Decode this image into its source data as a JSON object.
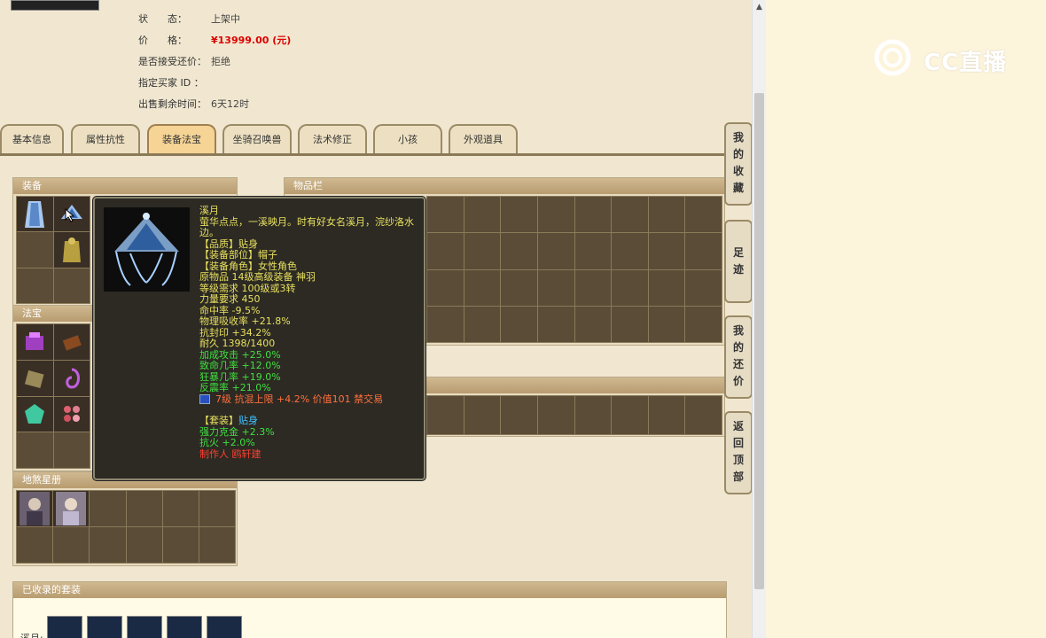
{
  "info": {
    "status_label": "状　　态：",
    "status_value": "上架中",
    "price_label": "价　　格：",
    "price_value": "¥13999.00 (元)",
    "bargain_label": "是否接受还价：",
    "bargain_value": "拒绝",
    "buyer_label": "指定买家 ID ：",
    "buyer_value": "",
    "remaining_label": "出售剩余时间：",
    "remaining_value": "6天12时"
  },
  "tabs": [
    {
      "label": "基本信息"
    },
    {
      "label": "属性抗性"
    },
    {
      "label": "装备法宝",
      "active": true
    },
    {
      "label": "坐骑召唤兽"
    },
    {
      "label": "法术修正"
    },
    {
      "label": "小孩"
    },
    {
      "label": "外观道具"
    }
  ],
  "panels": {
    "equipment": "装备",
    "treasure": "法宝",
    "tablet": "地煞星册",
    "inventory": "物品栏",
    "collected_sets": "已收录的套装"
  },
  "tooltip": {
    "name": "溪月",
    "desc1": "萤华点点，一溪映月。时有好女名溪月，浣纱洛水",
    "desc2": "边。",
    "quality": "【品质】贴身",
    "slot": "【装备部位】帽子",
    "role": "【装备角色】女性角色",
    "origin": "原物品 14级高级装备 神羽",
    "level_req": "等级需求 100级或3转",
    "str_req": "力量要求 450",
    "hit": "命中率 -9.5%",
    "phys_absorb": "物理吸收率 +21.8%",
    "seal_res": "抗封印 +34.2%",
    "durability": "耐久 1398/1400",
    "atk_bonus": "加成攻击 +25.0%",
    "crit_rate": "致命几率 +12.0%",
    "frenzy_rate": "狂暴几率 +19.0%",
    "counter_rate": "反震率 +21.0%",
    "gem_text": "7级 抗混上限 +4.2% 价值101 禁交易",
    "set_prefix": "【套装】",
    "set_name": "贴身",
    "set_bonus1": "强力克金 +2.3%",
    "set_bonus2": "抗火 +2.0%",
    "maker": "制作人 鸥轩建"
  },
  "side_buttons": [
    {
      "label": "我的收藏",
      "chars": [
        "我",
        "的",
        "收",
        "藏"
      ]
    },
    {
      "label": "足迹",
      "chars": [
        "足",
        "迹"
      ]
    },
    {
      "label": "我的还价",
      "chars": [
        "我",
        "的",
        "还",
        "价"
      ]
    },
    {
      "label": "返回顶部",
      "chars": [
        "返",
        "回",
        "顶",
        "部"
      ]
    }
  ],
  "set_row_label": "溪月:",
  "watermark": "CC直播",
  "colors": {
    "tooltip_name": "#e8e060",
    "tooltip_text": "#e8e060",
    "tooltip_green": "#40e040",
    "tooltip_cyan": "#40c0ff",
    "tooltip_red": "#ff4030",
    "tooltip_orange": "#ff7040",
    "price": "#dd0000"
  }
}
